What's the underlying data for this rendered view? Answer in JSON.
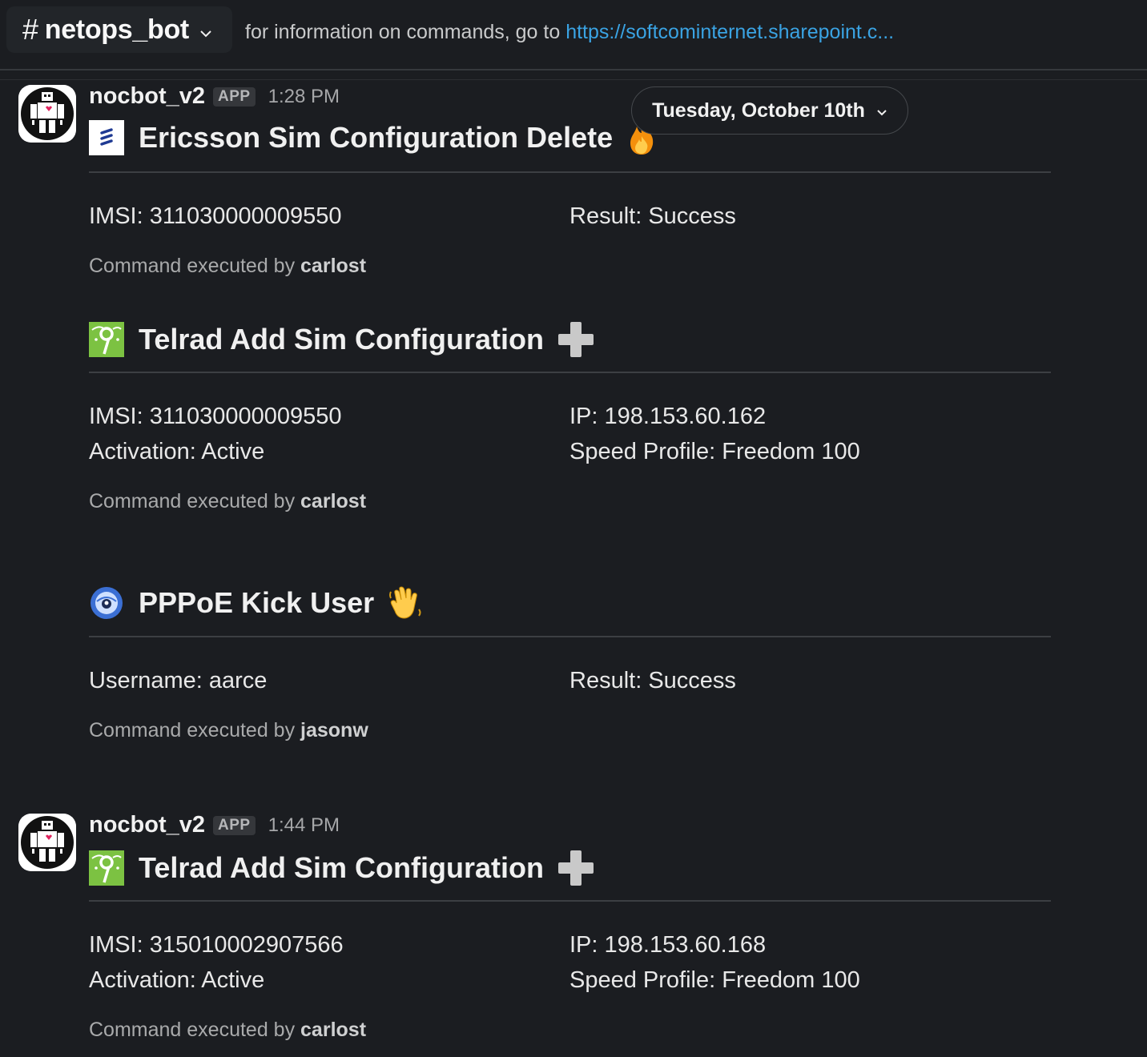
{
  "channel": {
    "name": "netops_bot",
    "hash": "#",
    "topic_text": "for information on commands, go to ",
    "topic_link": "https://softcominternet.sharepoint.c..."
  },
  "date_divider": "Tuesday, October 10th",
  "messages": [
    {
      "sender": "nocbot_v2",
      "badge": "APP",
      "time": "1:28 PM",
      "cards": [
        {
          "title": "Ericsson Sim Configuration Delete",
          "icon": "ericsson-logo-icon",
          "emoji": "fire-icon",
          "fields_left": [
            "IMSI: 311030000009550"
          ],
          "fields_right": [
            "Result: Success"
          ],
          "exec_prefix": "Command executed by ",
          "exec_user": "carlost"
        },
        {
          "title": "Telrad Add Sim Configuration",
          "icon": "telrad-logo-icon",
          "emoji": "plus-icon",
          "fields_left": [
            "IMSI: 311030000009550",
            "Activation: Active"
          ],
          "fields_right": [
            "IP: 198.153.60.162",
            "Speed Profile: Freedom 100"
          ],
          "exec_prefix": "Command executed by ",
          "exec_user": "carlost"
        },
        {
          "title": "PPPoE Kick User",
          "icon": "pppoe-globe-icon",
          "emoji": "waving-hand-icon",
          "fields_left": [
            "Username: aarce"
          ],
          "fields_right": [
            "Result: Success"
          ],
          "exec_prefix": "Command executed by ",
          "exec_user": "jasonw"
        }
      ]
    },
    {
      "sender": "nocbot_v2",
      "badge": "APP",
      "time": "1:44 PM",
      "cards": [
        {
          "title": "Telrad Add Sim Configuration",
          "icon": "telrad-logo-icon",
          "emoji": "plus-icon",
          "fields_left": [
            "IMSI: 315010002907566",
            "Activation: Active"
          ],
          "fields_right": [
            "IP: 198.153.60.168",
            "Speed Profile: Freedom 100"
          ],
          "exec_prefix": "Command executed by ",
          "exec_user": "carlost"
        }
      ]
    }
  ],
  "colors": {
    "background": "#1b1d21",
    "link": "#3aa3e3",
    "divider": "#3c3f43"
  }
}
